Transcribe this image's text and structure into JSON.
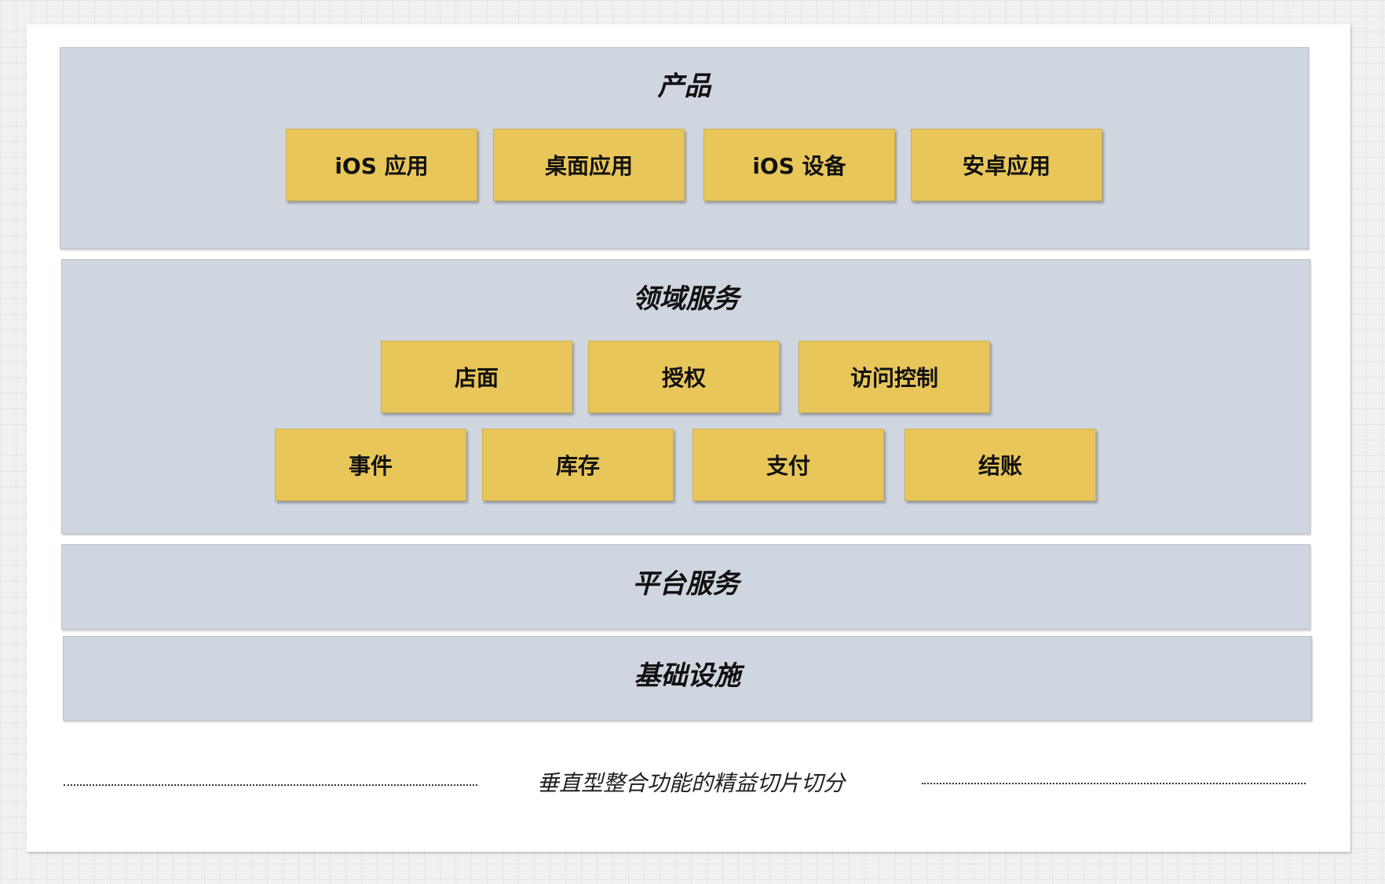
{
  "layers": {
    "products": {
      "title": "产品",
      "items": [
        "iOS 应用",
        "桌面应用",
        "iOS 设备",
        "安卓应用"
      ]
    },
    "domain_services": {
      "title": "领域服务",
      "row1": [
        "店面",
        "授权",
        "访问控制"
      ],
      "row2": [
        "事件",
        "库存",
        "支付",
        "结账"
      ]
    },
    "platform_services": {
      "title": "平台服务"
    },
    "infrastructure": {
      "title": "基础设施"
    }
  },
  "caption": "垂直型整合功能的精益切片切分"
}
